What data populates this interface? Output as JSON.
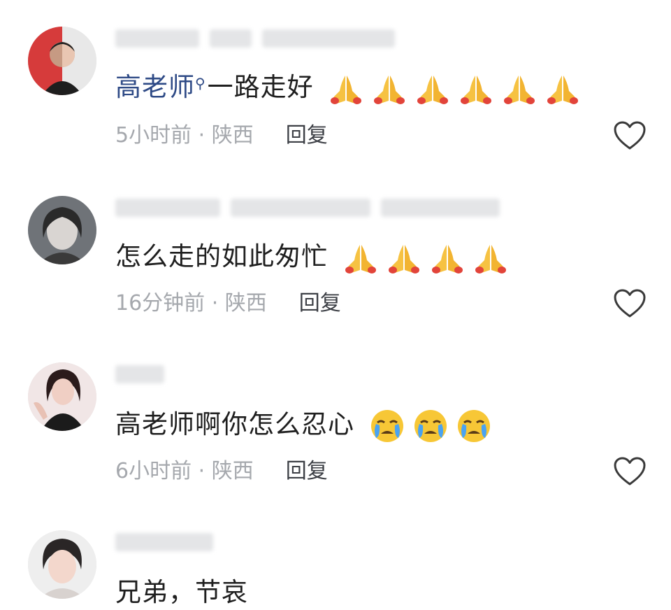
{
  "comments": [
    {
      "mention": "高老师",
      "text": "一路走好",
      "emoji": "folded-hands",
      "emoji_count": 6,
      "time": "5小时前",
      "location": "陕西",
      "reply_label": "回复"
    },
    {
      "text": "怎么走的如此匆忙",
      "emoji": "folded-hands",
      "emoji_count": 4,
      "time": "16分钟前",
      "location": "陕西",
      "reply_label": "回复"
    },
    {
      "text": "高老师啊你怎么忍心",
      "emoji": "crying-face",
      "emoji_count": 3,
      "time": "6小时前",
      "location": "陕西",
      "reply_label": "回复"
    },
    {
      "text": "兄弟，节哀"
    }
  ],
  "meta_separator": " · ",
  "colors": {
    "mention": "#2e4a86",
    "meta": "#a5a8ad",
    "reply": "#3c3f45"
  }
}
